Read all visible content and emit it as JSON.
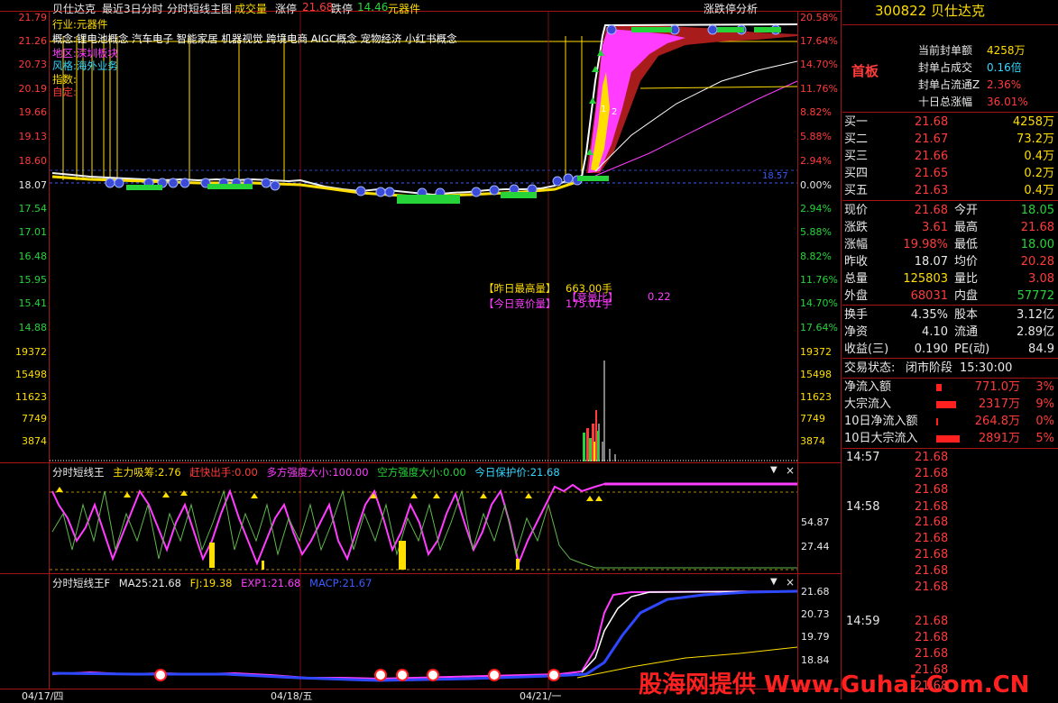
{
  "header": {
    "stock_name": "贝仕达克",
    "title": "最近3日分时",
    "indicator": "分时短线主图",
    "volume_label": "成交量",
    "limit_up_label": "涨停",
    "limit_up_value": "21.68",
    "limit_down_label": "跌停",
    "limit_down_value": "14.46",
    "sector": "元器件",
    "analysis_button": "涨跌停分析"
  },
  "overlay_text": {
    "industry": "行业:元器件",
    "concepts": "概念:锂电池概念 汽车电子 智能家居 机器视觉 跨境电商 AIGC概念 宠物经济 小红书概念",
    "region": "地区:深圳板块",
    "style": "风格:海外业务",
    "index": "指数:",
    "custom": "自定:"
  },
  "price_axis_left": [
    "21.79",
    "21.26",
    "20.73",
    "20.19",
    "19.66",
    "19.13",
    "18.60",
    "18.07",
    "17.54",
    "17.01",
    "16.48",
    "15.95",
    "15.41",
    "14.88"
  ],
  "price_axis_right": [
    "20.58%",
    "17.64%",
    "14.70%",
    "11.76%",
    "8.82%",
    "5.88%",
    "2.94%",
    "0.00%",
    "2.94%",
    "5.88%",
    "8.82%",
    "11.76%",
    "14.70%",
    "17.64%"
  ],
  "volume_axis": [
    "19372",
    "15498",
    "11623",
    "7749",
    "3874"
  ],
  "annotations": {
    "yesterday_max_label": "【昨日最高量】",
    "yesterday_max_value": "663.00手",
    "today_auction_label": "【今日竞价量】",
    "today_auction_value": "175.01手",
    "auction_ratio_label": "【竞量比】",
    "auction_ratio_value": "0.22",
    "chart_marker_1": "1",
    "chart_marker_2": "2",
    "avg_price_tag": "18.57"
  },
  "indicator1": {
    "name": "分时短线王",
    "s1_label": "主力吸筹:",
    "s1_value": "2.76",
    "s2_label": "赶快出手:",
    "s2_value": "0.00",
    "s3_label": "多方强度大小:",
    "s3_value": "100.00",
    "s4_label": "空方强度大小:",
    "s4_value": "0.00",
    "s5_label": "今日保护价:",
    "s5_value": "21.68",
    "axis": [
      "54.87",
      "27.44"
    ]
  },
  "indicator2": {
    "name": "分时短线王F",
    "s1_label": "MA25:",
    "s1_value": "21.68",
    "s2_label": "FJ:",
    "s2_value": "19.38",
    "s3_label": "EXP1:",
    "s3_value": "21.68",
    "s4_label": "MACP:",
    "s4_value": "21.67",
    "axis": [
      "21.68",
      "20.73",
      "19.79",
      "18.84"
    ]
  },
  "dates": [
    "04/17/四",
    "04/18/五",
    "04/21/一"
  ],
  "right_panel": {
    "code": "300822",
    "name": "贝仕达克",
    "board": "首板",
    "seal": [
      {
        "label": "当前封单额",
        "value": "4258万"
      },
      {
        "label": "封单占成交",
        "value": "0.16倍"
      },
      {
        "label": "封单占流通Z",
        "value": "2.36%"
      },
      {
        "label": "十日总涨幅",
        "value": "36.01%"
      }
    ],
    "bids": [
      {
        "label": "买一",
        "price": "21.68",
        "vol": "4258万"
      },
      {
        "label": "买二",
        "price": "21.67",
        "vol": "73.2万"
      },
      {
        "label": "买三",
        "price": "21.66",
        "vol": "0.4万"
      },
      {
        "label": "买四",
        "price": "21.65",
        "vol": "0.2万"
      },
      {
        "label": "买五",
        "price": "21.63",
        "vol": "0.4万"
      }
    ],
    "quote": [
      {
        "l1": "现价",
        "v1": "21.68",
        "l2": "今开",
        "v2": "18.05"
      },
      {
        "l1": "涨跌",
        "v1": "3.61",
        "l2": "最高",
        "v2": "21.68"
      },
      {
        "l1": "涨幅",
        "v1": "19.98%",
        "l2": "最低",
        "v2": "18.00"
      },
      {
        "l1": "昨收",
        "v1": "18.07",
        "l2": "均价",
        "v2": "20.28"
      },
      {
        "l1": "总量",
        "v1": "125803",
        "l2": "量比",
        "v2": "3.08"
      },
      {
        "l1": "外盘",
        "v1": "68031",
        "l2": "内盘",
        "v2": "57772"
      }
    ],
    "fund": [
      {
        "l1": "换手",
        "v1": "4.35%",
        "l2": "股本",
        "v2": "3.12亿"
      },
      {
        "l1": "净资",
        "v1": "4.10",
        "l2": "流通",
        "v2": "2.89亿"
      },
      {
        "l1": "收益(三)",
        "v1": "0.190",
        "l2": "PE(动)",
        "v2": "84.9"
      }
    ],
    "status_label": "交易状态:",
    "status_value": "闭市阶段",
    "status_time": "15:30:00",
    "flows": [
      {
        "label": "净流入额",
        "value": "771.0万",
        "pct": "3%"
      },
      {
        "label": "大宗流入",
        "value": "2317万",
        "pct": "9%"
      },
      {
        "label": "10日净流入额",
        "value": "264.8万",
        "pct": "0%"
      },
      {
        "label": "10日大宗流入",
        "value": "2891万",
        "pct": "5%"
      }
    ],
    "ticks": [
      {
        "time": "14:57",
        "price": "21.68"
      },
      {
        "time": "",
        "price": "21.68"
      },
      {
        "time": "",
        "price": "21.68"
      },
      {
        "time": "14:58",
        "price": "21.68"
      },
      {
        "time": "",
        "price": "21.68"
      },
      {
        "time": "",
        "price": "21.68"
      },
      {
        "time": "",
        "price": "21.68"
      },
      {
        "time": "",
        "price": "21.68"
      },
      {
        "time": "",
        "price": "21.68"
      },
      {
        "time": "14:59",
        "price": "21.68"
      },
      {
        "time": "",
        "price": "21.68"
      },
      {
        "time": "",
        "price": "21.68"
      },
      {
        "time": "",
        "price": "21.68"
      },
      {
        "time": "",
        "price": "21.68"
      }
    ]
  },
  "watermark": "股海网提供 Www.Guhai.Com.CN",
  "colors": {
    "up": "#ff3b3b",
    "down": "#26d43a",
    "neutral": "#e8e8e8",
    "frame": "#a51414",
    "accent_yellow": "#ffde00"
  }
}
